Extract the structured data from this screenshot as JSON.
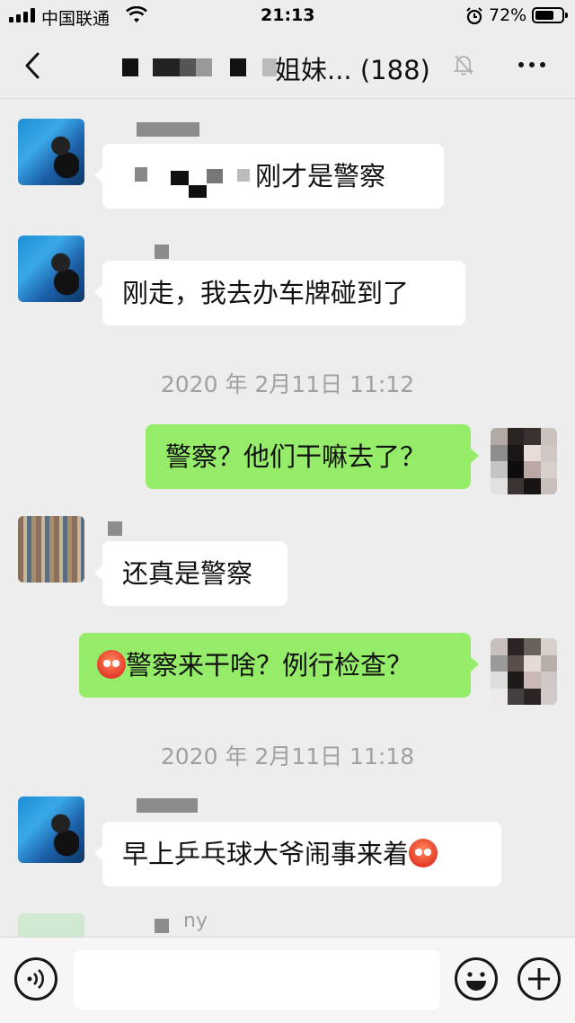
{
  "status_bar": {
    "carrier": "中国联通",
    "time": "21:13",
    "battery_percent": "72%",
    "battery_level": 0.72
  },
  "header": {
    "title": "姐妹... (188)",
    "icons": [
      "back-icon",
      "mute-bell-icon",
      "more-icon"
    ]
  },
  "messages": [
    {
      "type": "incoming",
      "text": "刚才是警察",
      "avatar": "diver-avatar"
    },
    {
      "type": "incoming",
      "text": "刚走，我去办车牌碰到了",
      "avatar": "diver-avatar"
    },
    {
      "type": "timestamp",
      "text": "2020 年 2月11日 11:12"
    },
    {
      "type": "outgoing",
      "text": "警察？他们干嘛去了？",
      "avatar": "pixelated-avatar"
    },
    {
      "type": "incoming",
      "text": "还真是警察",
      "avatar": "city-avatar"
    },
    {
      "type": "outgoing",
      "text": "警察来干啥？例行检查？",
      "emoji": "flushed-face-emoji",
      "avatar": "pixelated-avatar"
    },
    {
      "type": "timestamp",
      "text": "2020 年 2月11日 11:18"
    },
    {
      "type": "incoming",
      "text": "早上乒乓球大爷闹事来着",
      "emoji": "flushed-face-emoji",
      "avatar": "diver-avatar"
    }
  ],
  "partial_sender": "ny",
  "input_bar": {
    "placeholder": "",
    "icons": [
      "voice-icon",
      "emoji-icon",
      "plus-icon"
    ]
  },
  "colors": {
    "background": "#ededed",
    "outgoing_bubble": "#95ec69",
    "incoming_bubble": "#ffffff",
    "timestamp_text": "#a0a0a0"
  }
}
